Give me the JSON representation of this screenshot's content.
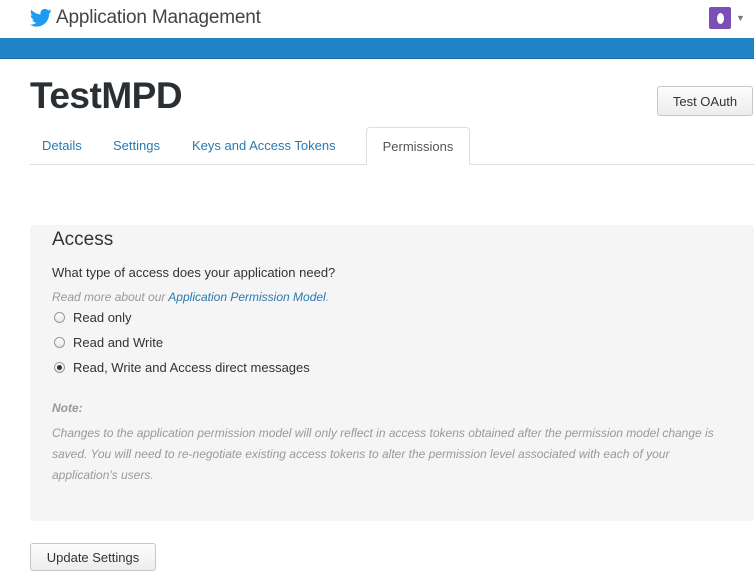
{
  "header": {
    "app_title": "Application Management",
    "brand_icon": "twitter-bird-icon",
    "avatar_color": "#7b4fb5",
    "accent_color": "#1f84c6"
  },
  "app": {
    "name": "TestMPD",
    "test_oauth_label": "Test OAuth"
  },
  "tabs": [
    {
      "label": "Details"
    },
    {
      "label": "Settings"
    },
    {
      "label": "Keys and Access Tokens"
    },
    {
      "label": "Permissions",
      "active": true
    }
  ],
  "access": {
    "title": "Access",
    "question": "What type of access does your application need?",
    "read_more_prefix": "Read more about our ",
    "read_more_link": "Application Permission Model",
    "read_more_suffix": ".",
    "options": [
      {
        "label": "Read only",
        "checked": false
      },
      {
        "label": "Read and Write",
        "checked": false
      },
      {
        "label": "Read, Write and Access direct messages",
        "checked": true
      }
    ],
    "note_label": "Note:",
    "note_text": "Changes to the application permission model will only reflect in access tokens obtained after the permission model change is saved. You will need to re-negotiate existing access tokens to alter the permission level associated with each of your application's users."
  },
  "actions": {
    "update_label": "Update Settings"
  }
}
